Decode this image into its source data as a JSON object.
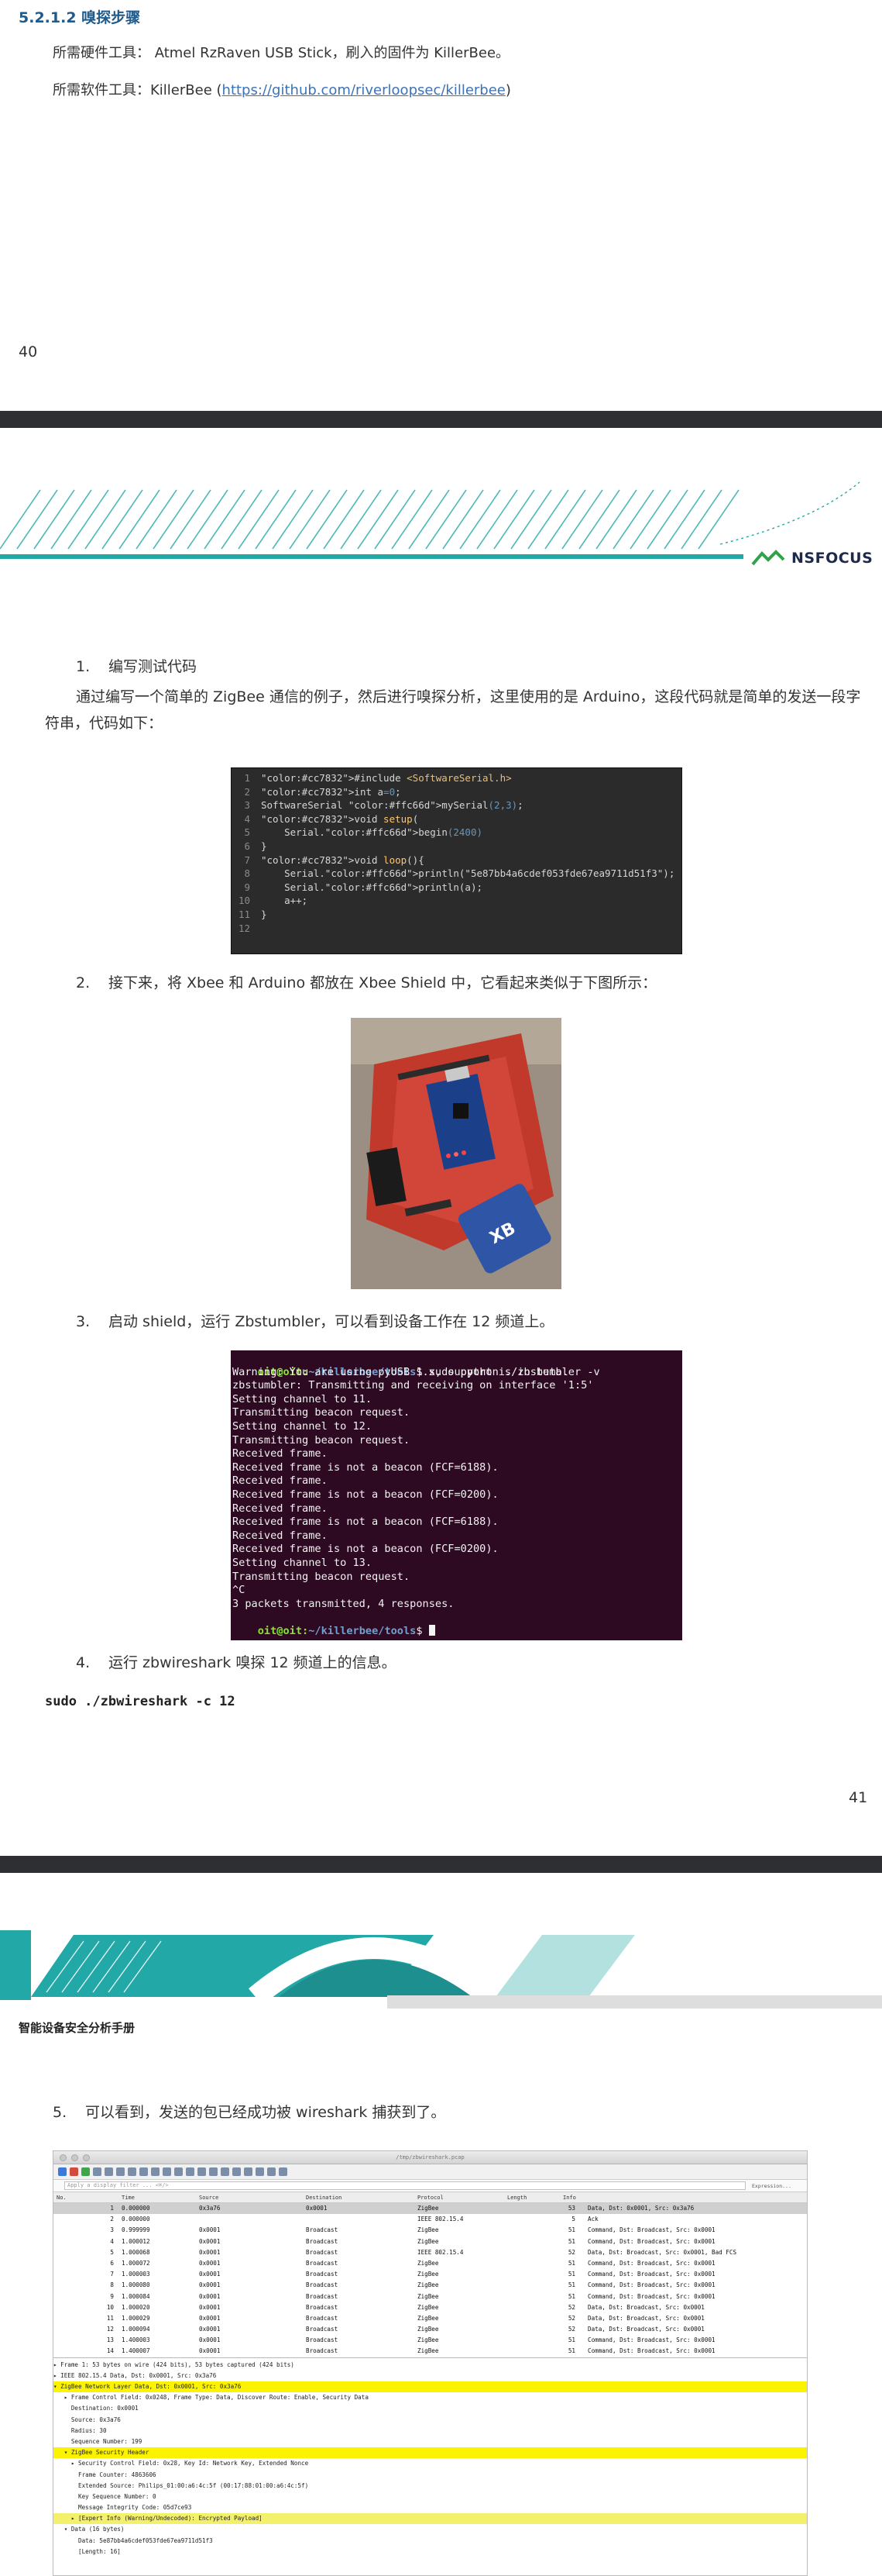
{
  "page40": {
    "heading": "5.2.1.2 嗅探步骤",
    "hardware": "所需硬件工具： Atmel RzRaven USB Stick，刷入的固件为 KillerBee。",
    "software_prefix": "所需软件工具：KillerBee (",
    "software_link": "https://github.com/riverloopsec/killerbee",
    "software_suffix": ")",
    "page_number": "40"
  },
  "page41": {
    "logo_text": "NSFOCUS",
    "step1": {
      "num": "1.",
      "label": "编写测试代码"
    },
    "paragraph": "通过编写一个简单的 ZigBee 通信的例子，然后进行嗅探分析，这里使用的是 Arduino，这段代码就是简单的发送一段字符串，代码如下：",
    "code": [
      {
        "n": "1",
        "t": "#include <SoftwareSerial.h>"
      },
      {
        "n": "2",
        "t": "int a=0;"
      },
      {
        "n": "3",
        "t": "SoftwareSerial mySerial(2,3);"
      },
      {
        "n": "4",
        "t": "void setup("
      },
      {
        "n": "5",
        "t": "    Serial.begin(2400)"
      },
      {
        "n": "6",
        "t": "}"
      },
      {
        "n": "7",
        "t": "void loop(){"
      },
      {
        "n": "8",
        "t": "    Serial.println(\"5e87bb4a6cdef053fde67ea9711d51f3\");"
      },
      {
        "n": "9",
        "t": "    Serial.println(a);"
      },
      {
        "n": "10",
        "t": "    a++;"
      },
      {
        "n": "11",
        "t": "}"
      },
      {
        "n": "12",
        "t": ""
      }
    ],
    "step2": {
      "num": "2.",
      "label": "接下来，将 Xbee 和 Arduino 都放在 Xbee Shield 中，它看起来类似于下图所示："
    },
    "step3": {
      "num": "3.",
      "label": "启动 shield，运行 Zbstumbler，可以看到设备工作在 12 频道上。"
    },
    "terminal_prompt": "oit@oit:",
    "terminal_path": "~/killerbee/tools",
    "terminal_cmd": "$ sudo python ./zbstumbler -v",
    "terminal_lines": [
      "Warning: You are using pyUSB 1.x, support is in beta.",
      "zbstumbler: Transmitting and receiving on interface '1:5'",
      "Setting channel to 11.",
      "Transmitting beacon request.",
      "Setting channel to 12.",
      "Transmitting beacon request.",
      "Received frame.",
      "Received frame is not a beacon (FCF=6188).",
      "Received frame.",
      "Received frame is not a beacon (FCF=0200).",
      "Received frame.",
      "Received frame is not a beacon (FCF=6188).",
      "Received frame.",
      "Received frame is not a beacon (FCF=0200).",
      "Setting channel to 13.",
      "Transmitting beacon request.",
      "^C",
      "3 packets transmitted, 4 responses."
    ],
    "terminal_end": "$ ",
    "step4": {
      "num": "4.",
      "label": "运行 zbwireshark 嗅探 12 频道上的信息。"
    },
    "command": "sudo ./zbwireshark -c 12",
    "page_number": "41"
  },
  "page42": {
    "manual_title": "智能设备安全分析手册",
    "step5": {
      "num": "5.",
      "label": "可以看到，发送的包已经成功被 wireshark 捕获到了。"
    },
    "wireshark": {
      "window_name": "/tmp/zbwireshark.pcap",
      "filter_placeholder": "Apply a display filter ... <⌘/>",
      "expression": "Expression...",
      "columns": [
        "No.",
        "Time",
        "Source",
        "Destination",
        "Protocol",
        "Length",
        "Info"
      ],
      "packets": [
        [
          "1",
          "0.000000",
          "0x3a76",
          "0x0001",
          "ZigBee",
          "53",
          "Data, Dst: 0x0001, Src: 0x3a76"
        ],
        [
          "2",
          "0.000000",
          "",
          "",
          "IEEE 802.15.4",
          "5",
          "Ack"
        ],
        [
          "3",
          "0.999999",
          "0x0001",
          "Broadcast",
          "ZigBee",
          "51",
          "Command, Dst: Broadcast, Src: 0x0001"
        ],
        [
          "4",
          "1.000012",
          "0x0001",
          "Broadcast",
          "ZigBee",
          "51",
          "Command, Dst: Broadcast, Src: 0x0001"
        ],
        [
          "5",
          "1.000068",
          "0x0001",
          "Broadcast",
          "IEEE 802.15.4",
          "52",
          "Data, Dst: Broadcast, Src: 0x0001, Bad FCS"
        ],
        [
          "6",
          "1.000072",
          "0x0001",
          "Broadcast",
          "ZigBee",
          "51",
          "Command, Dst: Broadcast, Src: 0x0001"
        ],
        [
          "7",
          "1.000003",
          "0x0001",
          "Broadcast",
          "ZigBee",
          "51",
          "Command, Dst: Broadcast, Src: 0x0001"
        ],
        [
          "8",
          "1.000080",
          "0x0001",
          "Broadcast",
          "ZigBee",
          "51",
          "Command, Dst: Broadcast, Src: 0x0001"
        ],
        [
          "9",
          "1.000084",
          "0x0001",
          "Broadcast",
          "ZigBee",
          "51",
          "Command, Dst: Broadcast, Src: 0x0001"
        ],
        [
          "10",
          "1.000020",
          "0x0001",
          "Broadcast",
          "ZigBee",
          "52",
          "Data, Dst: Broadcast, Src: 0x0001"
        ],
        [
          "11",
          "1.000029",
          "0x0001",
          "Broadcast",
          "ZigBee",
          "52",
          "Data, Dst: Broadcast, Src: 0x0001"
        ],
        [
          "12",
          "1.000094",
          "0x0001",
          "Broadcast",
          "ZigBee",
          "52",
          "Data, Dst: Broadcast, Src: 0x0001"
        ],
        [
          "13",
          "1.400003",
          "0x0001",
          "Broadcast",
          "ZigBee",
          "51",
          "Command, Dst: Broadcast, Src: 0x0001"
        ],
        [
          "14",
          "1.400007",
          "0x0001",
          "Broadcast",
          "ZigBee",
          "51",
          "Command, Dst: Broadcast, Src: 0x0001"
        ]
      ],
      "details": [
        {
          "t": "▸ Frame 1: 53 bytes on wire (424 bits), 53 bytes captured (424 bits)",
          "hl": ""
        },
        {
          "t": "▸ IEEE 802.15.4 Data, Dst: 0x0001, Src: 0x3a76",
          "hl": ""
        },
        {
          "t": "▾ ZigBee Network Layer Data, Dst: 0x0001, Src: 0x3a76",
          "hl": "hl"
        },
        {
          "t": "   ▸ Frame Control Field: 0x0248, Frame Type: Data, Discover Route: Enable, Security Data",
          "hl": ""
        },
        {
          "t": "     Destination: 0x0001",
          "hl": ""
        },
        {
          "t": "     Source: 0x3a76",
          "hl": ""
        },
        {
          "t": "     Radius: 30",
          "hl": ""
        },
        {
          "t": "     Sequence Number: 199",
          "hl": ""
        },
        {
          "t": "   ▾ ZigBee Security Header",
          "hl": "hl"
        },
        {
          "t": "     ▸ Security Control Field: 0x28, Key Id: Network Key, Extended Nonce",
          "hl": ""
        },
        {
          "t": "       Frame Counter: 4863606",
          "hl": ""
        },
        {
          "t": "       Extended Source: Philips_01:00:a6:4c:5f (00:17:88:01:00:a6:4c:5f)",
          "hl": ""
        },
        {
          "t": "       Key Sequence Number: 0",
          "hl": ""
        },
        {
          "t": "       Message Integrity Code: 05d7ce93",
          "hl": ""
        },
        {
          "t": "     ▸ [Expert Info (Warning/Undecoded): Encrypted Payload]",
          "hl": "hl2"
        },
        {
          "t": "   ▾ Data (16 bytes)",
          "hl": ""
        },
        {
          "t": "       Data: 5e87bb4a6cdef053fde67ea9711d51f3",
          "hl": ""
        },
        {
          "t": "       [Length: 16]",
          "hl": ""
        }
      ]
    }
  },
  "colors": {
    "heading": "#1f5a8a",
    "link": "#3b73b9",
    "teal": "#21a8a7",
    "dark_band": "#2e2f33",
    "terminal_bg": "#2d0a22",
    "editor_bg": "#2b2b2b",
    "highlight": "#fbf300"
  }
}
